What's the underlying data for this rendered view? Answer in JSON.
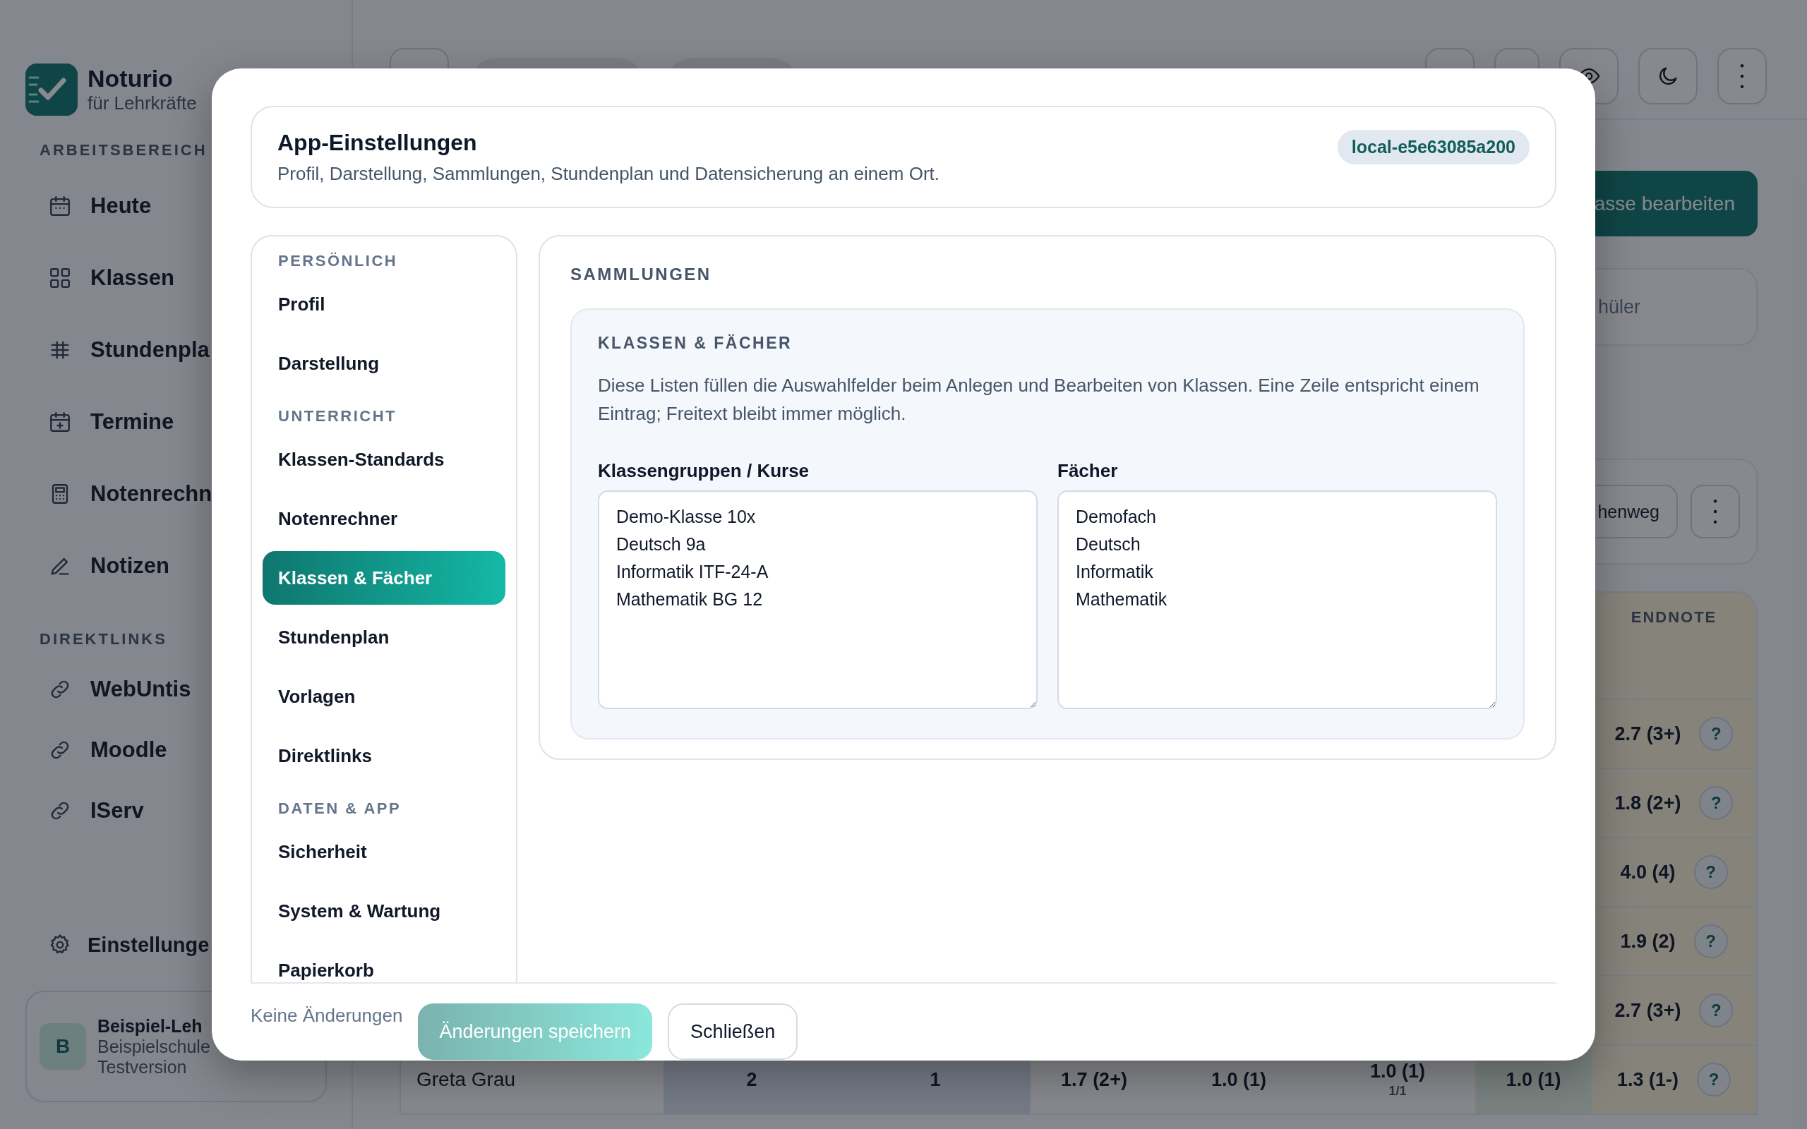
{
  "app": {
    "brand": {
      "name": "Noturio",
      "tagline": "für Lehrkräfte"
    },
    "sidebar": {
      "sections": [
        {
          "label": "ARBEITSBEREICH",
          "items": [
            {
              "label": "Heute"
            },
            {
              "label": "Klassen"
            },
            {
              "label": "Stundenpla"
            },
            {
              "label": "Termine"
            },
            {
              "label": "Notenrechn"
            },
            {
              "label": "Notizen"
            }
          ]
        },
        {
          "label": "DIREKTLINKS",
          "items": [
            {
              "label": "WebUntis"
            },
            {
              "label": "Moodle"
            },
            {
              "label": "IServ"
            }
          ]
        }
      ],
      "settings": "Einstellunge",
      "profile": {
        "initial": "B",
        "name": "Beispiel-Leh",
        "school": "Beispielschule",
        "plan": "Testversion"
      }
    },
    "edit_button": "asse bearbeiten",
    "search": {
      "placeholder": "hüler"
    },
    "action_button": "henweg",
    "table": {
      "header": "ENDNOTE",
      "rows": [
        {
          "grade": "2.7 (3+)",
          "help": "?"
        },
        {
          "grade": "1.8 (2+)",
          "help": "?"
        },
        {
          "grade": "4.0 (4)",
          "help": "?"
        },
        {
          "grade": "1.9 (2)",
          "help": "?"
        },
        {
          "grade": "2.7 (3+)",
          "help": "?"
        }
      ],
      "last_row": {
        "name": "Greta Grau",
        "cells": [
          "2",
          "1",
          "1.7 (2+)",
          "1.0 (1)",
          "1.0 (1)",
          "1.0 (1)"
        ],
        "cell_note": "1/1",
        "grade": "1.3 (1-)",
        "help": "?"
      }
    }
  },
  "dialog": {
    "title": "App-Einstellungen",
    "subtitle": "Profil, Darstellung, Sammlungen, Stundenplan und Datensicherung an einem Ort.",
    "badge": "local-e5e63085a200",
    "nav": [
      {
        "label": "PERSÖNLICH",
        "items": [
          {
            "label": "Profil",
            "selected": false
          },
          {
            "label": "Darstellung",
            "selected": false
          }
        ]
      },
      {
        "label": "UNTERRICHT",
        "items": [
          {
            "label": "Klassen-Standards",
            "selected": false
          },
          {
            "label": "Notenrechner",
            "selected": false
          },
          {
            "label": "Klassen & Fächer",
            "selected": true
          },
          {
            "label": "Stundenplan",
            "selected": false
          },
          {
            "label": "Vorlagen",
            "selected": false
          },
          {
            "label": "Direktlinks",
            "selected": false
          }
        ]
      },
      {
        "label": "DATEN & APP",
        "items": [
          {
            "label": "Sicherheit",
            "selected": false
          },
          {
            "label": "System & Wartung",
            "selected": false
          },
          {
            "label": "Papierkorb",
            "selected": false
          }
        ]
      }
    ],
    "section_title": "SAMMLUNGEN",
    "panel": {
      "title": "KLASSEN & FÄCHER",
      "description": "Diese Listen füllen die Auswahlfelder beim Anlegen und Bearbeiten von Klassen. Eine Zeile entspricht einem Eintrag; Freitext bleibt immer möglich.",
      "fields": [
        {
          "label": "Klassengruppen / Kurse",
          "value": "Demo-Klasse 10x\nDeutsch 9a\nInformatik ITF-24-A\nMathematik BG 12"
        },
        {
          "label": "Fächer",
          "value": "Demofach\nDeutsch\nInformatik\nMathematik"
        }
      ]
    },
    "status": "Keine Änderungen",
    "buttons": [
      {
        "label": "Änderungen speichern",
        "kind": "primary",
        "disabled": true
      },
      {
        "label": "Schließen",
        "kind": "secondary",
        "disabled": false
      }
    ]
  }
}
